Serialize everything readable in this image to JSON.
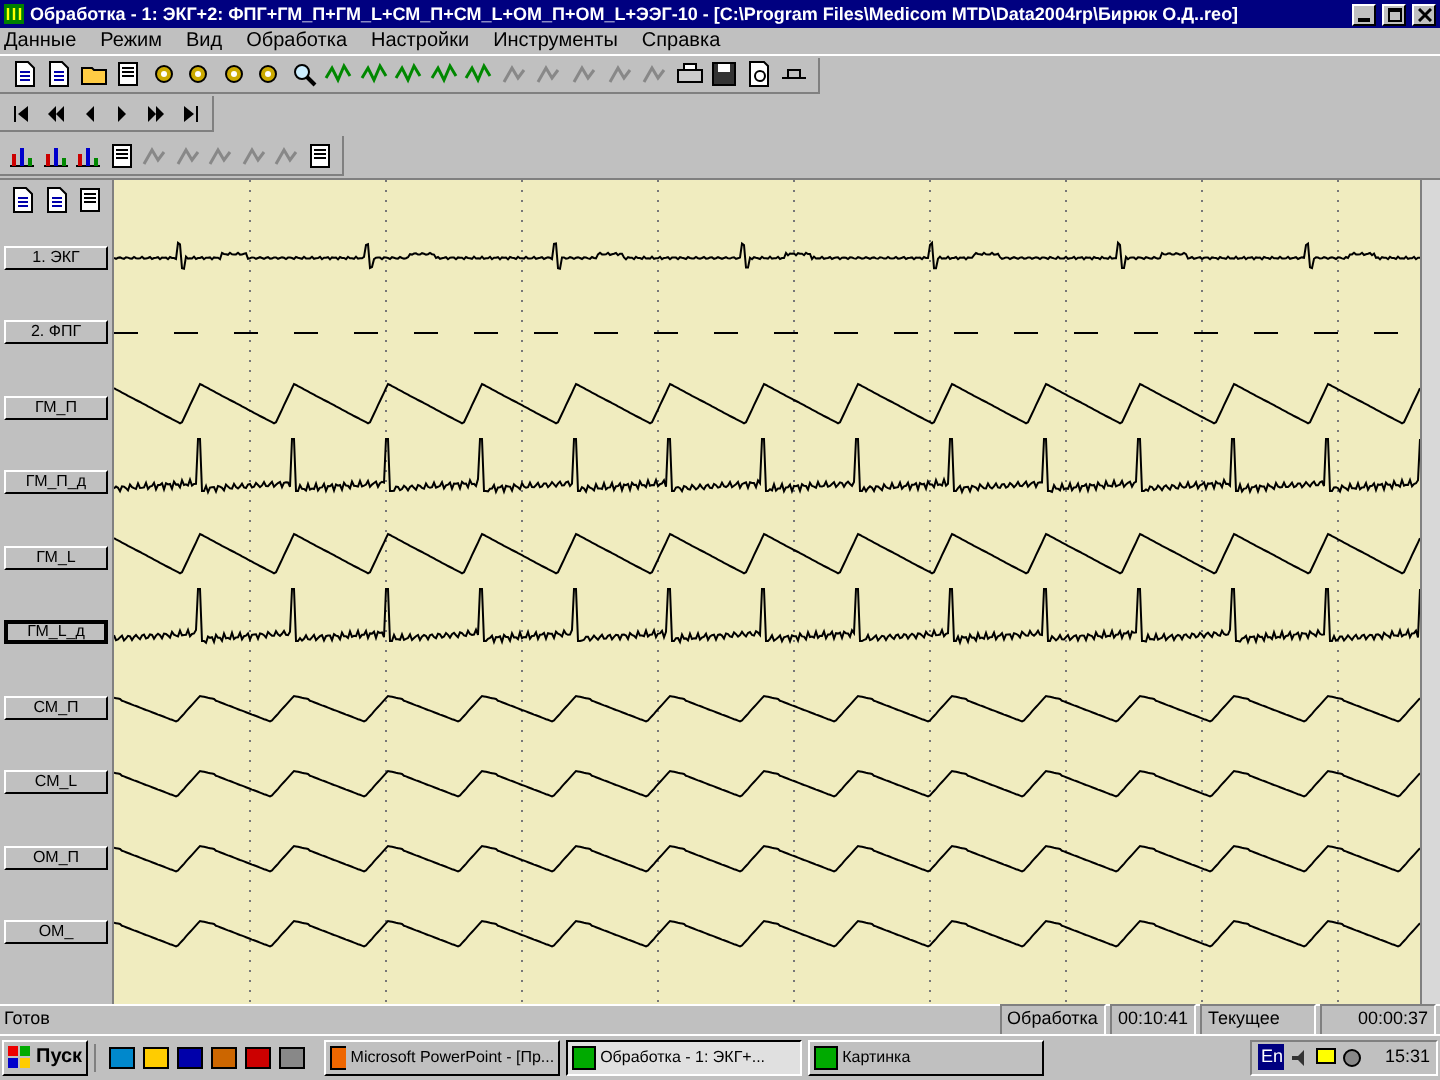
{
  "window": {
    "title": "Обработка - 1: ЭКГ+2: ФПГ+ГМ_П+ГМ_L+СМ_П+СМ_L+ОМ_П+ОМ_L+ЭЭГ-10 - [C:\\Program Files\\Medicom MTD\\Data2004rp\\Бирюк О.Д..reo]"
  },
  "menu": [
    "Данные",
    "Режим",
    "Вид",
    "Обработка",
    "Настройки",
    "Инструменты",
    "Справка"
  ],
  "channels": [
    {
      "label": "1. ЭКГ",
      "kind": "ecg",
      "selected": false
    },
    {
      "label": "2. ФПГ",
      "kind": "dashes",
      "selected": false
    },
    {
      "label": "ГМ_П",
      "kind": "pulse",
      "selected": false
    },
    {
      "label": "ГМ_П_д",
      "kind": "spiky",
      "selected": false
    },
    {
      "label": "ГМ_L",
      "kind": "pulse",
      "selected": false
    },
    {
      "label": "ГМ_L_д",
      "kind": "spiky",
      "selected": true
    },
    {
      "label": "СМ_П",
      "kind": "wave",
      "selected": false
    },
    {
      "label": "СМ_L",
      "kind": "wave",
      "selected": false
    },
    {
      "label": "ОМ_П",
      "kind": "wave",
      "selected": false
    },
    {
      "label": "ОМ_",
      "kind": "wave",
      "selected": false
    }
  ],
  "status_bar": {
    "message": "Готов",
    "mode_label": "Обработка",
    "mode_time": "00:10:41",
    "current_label": "Текущее",
    "current_time": "00:00:37"
  },
  "taskbar": {
    "start": "Пуск",
    "tasks": [
      {
        "label": "Microsoft PowerPoint - [Пр...",
        "selected": false
      },
      {
        "label": "Обработка - 1: ЭКГ+...",
        "selected": true
      },
      {
        "label": "Картинка",
        "selected": false
      }
    ],
    "language": "En",
    "clock": "15:31"
  }
}
